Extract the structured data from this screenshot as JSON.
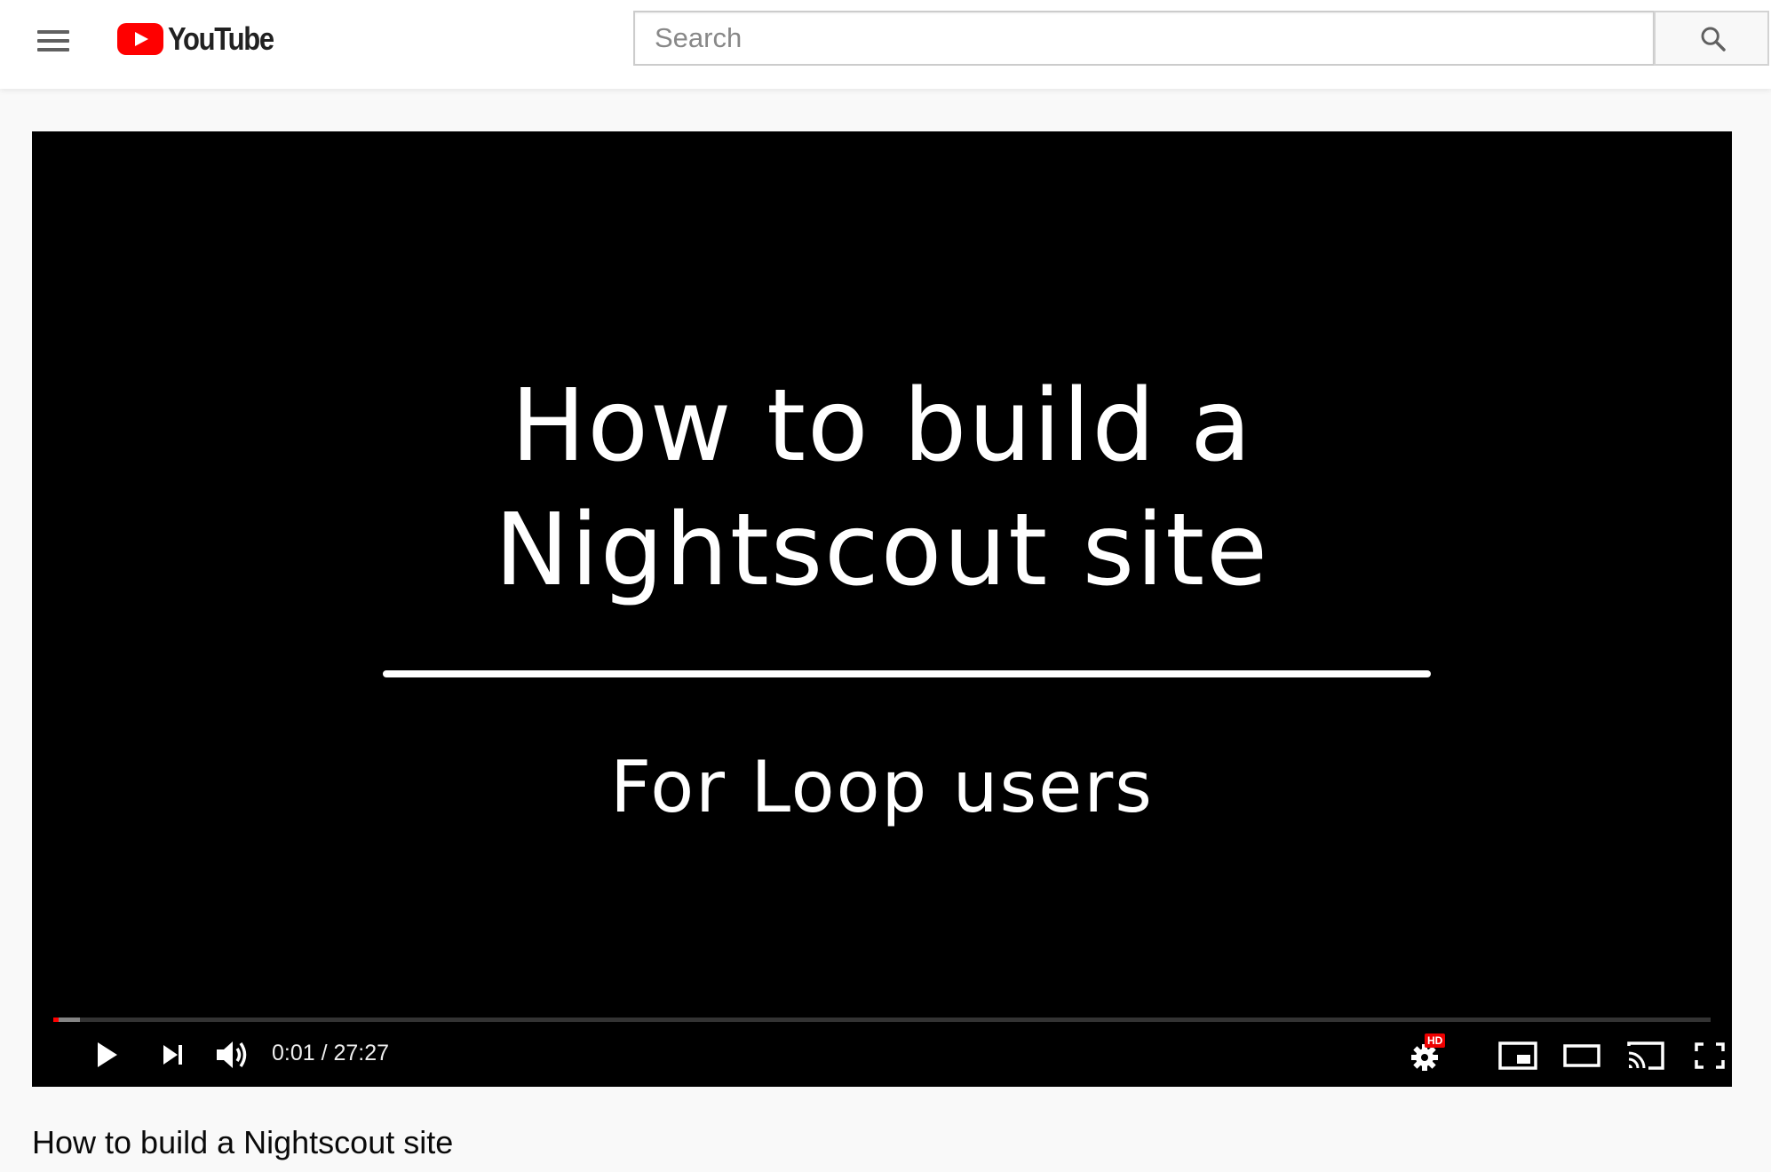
{
  "header": {
    "menu_icon": "hamburger-menu-icon",
    "logo_text": "YouTube",
    "search_placeholder": "Search",
    "search_value": "",
    "search_icon": "search-icon"
  },
  "player": {
    "slide": {
      "line1": "How to build a",
      "line2": "Nightscout site",
      "subtitle": "For Loop users"
    },
    "progress": {
      "played_fraction": 0.0006,
      "loaded_fraction": 0.016
    },
    "current_time": "0:01",
    "duration": "27:27",
    "time_display": "0:01 / 27:27",
    "controls_left": [
      "play-icon",
      "next-icon",
      "volume-icon"
    ],
    "controls_right": [
      "settings-icon",
      "miniplayer-icon",
      "theater-mode-icon",
      "cast-icon",
      "fullscreen-icon"
    ],
    "settings_badge": "HD"
  },
  "video": {
    "title": "How to build a Nightscout site"
  },
  "colors": {
    "brand_red": "#ff0000",
    "player_bg": "#000000",
    "page_bg": "#f9f9f9"
  }
}
